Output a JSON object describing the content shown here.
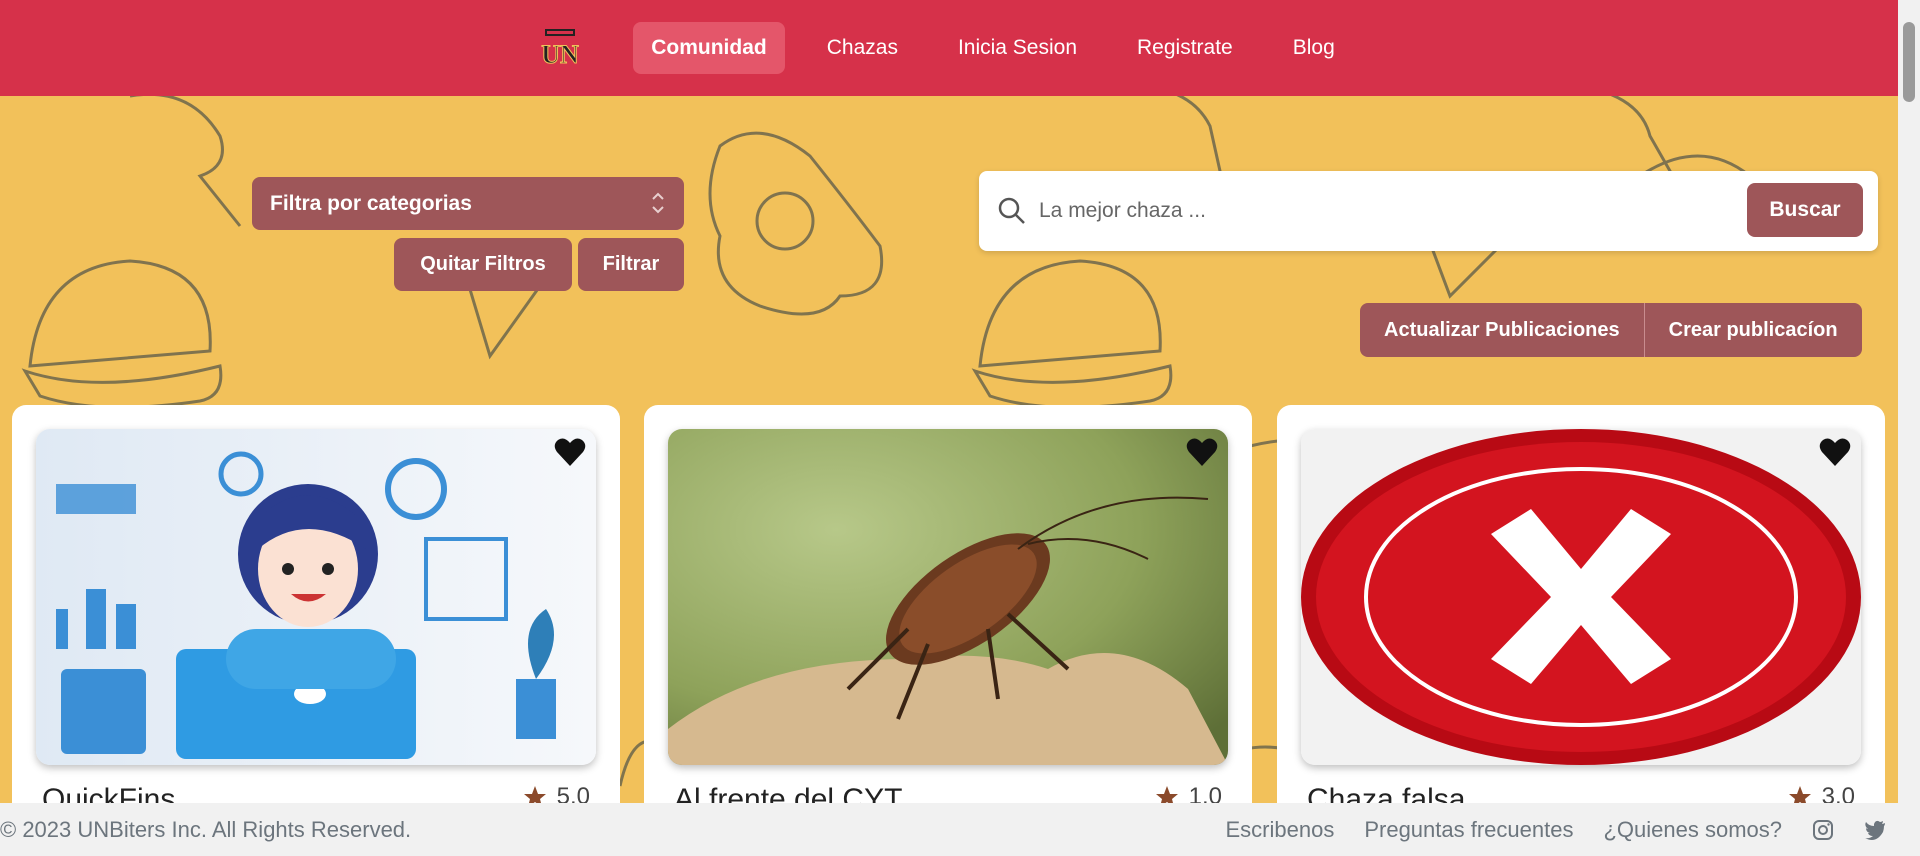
{
  "nav": {
    "logo_text": "UN",
    "links": [
      {
        "label": "Comunidad",
        "active": true
      },
      {
        "label": "Chazas"
      },
      {
        "label": "Inicia Sesion"
      },
      {
        "label": "Registrate"
      },
      {
        "label": "Blog"
      }
    ]
  },
  "filters": {
    "category_select": "Filtra por categorias",
    "clear_label": "Quitar Filtros",
    "filter_label": "Filtrar"
  },
  "search": {
    "placeholder": "La mejor chaza ...",
    "button_label": "Buscar"
  },
  "actions": {
    "refresh_label": "Actualizar Publicaciones",
    "create_label": "Crear publicacíon"
  },
  "cards": [
    {
      "title": "QuickFins",
      "rating": "5.0",
      "image": "finance-illustration"
    },
    {
      "title": "Al frente del CYT",
      "rating": "1.0",
      "image": "cockroach-photo"
    },
    {
      "title": "Chaza falsa",
      "rating": "3.0",
      "image": "red-x-seal"
    }
  ],
  "footer": {
    "copyright": "© 2023 UNBiters Inc. All Rights Reserved.",
    "links": [
      "Escribenos",
      "Preguntas frecuentes",
      "¿Quienes somos?"
    ],
    "icons": [
      "instagram-icon",
      "twitter-icon"
    ]
  },
  "colors": {
    "navbar": "#d6314a",
    "background": "#f2c15a",
    "button": "#9e5659"
  }
}
